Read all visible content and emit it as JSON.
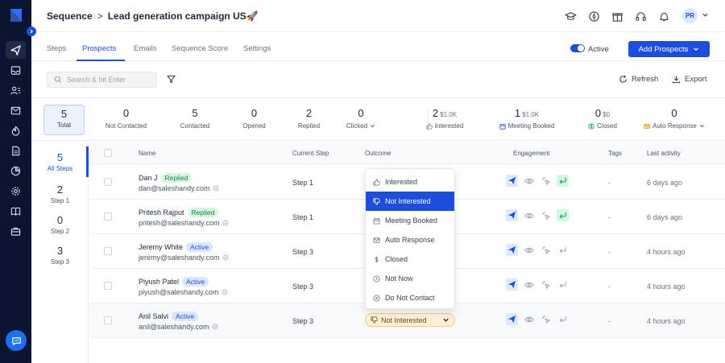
{
  "header": {
    "breadcrumb_root": "Sequence",
    "breadcrumb_sep": ">",
    "breadcrumb_current": "Lead generation campaign US",
    "title_emoji": "🚀",
    "avatar_initials": "PR"
  },
  "tabs": [
    {
      "label": "Steps"
    },
    {
      "label": "Prospects"
    },
    {
      "label": "Emails"
    },
    {
      "label": "Sequence Score"
    },
    {
      "label": "Settings"
    }
  ],
  "active_tab": "Prospects",
  "toggle": {
    "label": "Active",
    "on": true
  },
  "add_prospects_label": "Add Prospects",
  "search": {
    "placeholder": "Search & hit Enter"
  },
  "toolbar": {
    "refresh_label": "Refresh",
    "export_label": "Export"
  },
  "stats": {
    "total": {
      "value": "5",
      "label": "Total"
    },
    "not_contacted": {
      "value": "0",
      "label": "Not Contacted"
    },
    "contacted": {
      "value": "5",
      "label": "Contacted"
    },
    "opened": {
      "value": "0",
      "label": "Opened"
    },
    "replied": {
      "value": "2",
      "label": "Replied"
    },
    "clicked": {
      "value": "0",
      "label": "Clicked"
    },
    "interested": {
      "value": "2",
      "amount": "$1.0K",
      "label": "Interested"
    },
    "meeting_booked": {
      "value": "1",
      "amount": "$1.0K",
      "label": "Meeting Booked"
    },
    "closed": {
      "value": "0",
      "amount": "$0",
      "label": "Closed"
    },
    "auto_response": {
      "value": "0",
      "label": "Auto Response"
    }
  },
  "steps": [
    {
      "value": "5",
      "label": "All Steps"
    },
    {
      "value": "2",
      "label": "Step 1"
    },
    {
      "value": "0",
      "label": "Step 2"
    },
    {
      "value": "3",
      "label": "Step 3"
    }
  ],
  "table": {
    "columns": {
      "name": "Name",
      "current_step": "Current Step",
      "outcome": "Outcome",
      "engagement": "Engagement",
      "tags": "Tags",
      "last_activity": "Last activity"
    },
    "rows": [
      {
        "name": "Dan J",
        "status": "Replied",
        "email": "dan@saleshandy.com",
        "step": "Step 1",
        "tags": "-",
        "last": "6 days ago"
      },
      {
        "name": "Pritesh Rajput",
        "status": "Replied",
        "email": "pritesh@saleshandy.com",
        "step": "Step 1",
        "tags": "-",
        "last": "6 days ago"
      },
      {
        "name": "Jeremy White",
        "status": "Active",
        "email": "jeremy@saleshandy.com",
        "step": "Step 3",
        "tags": "-",
        "last": "4 hours ago"
      },
      {
        "name": "Piyush Patel",
        "status": "Active",
        "email": "piyush@saleshandy.com",
        "step": "Step 3",
        "tags": "-",
        "last": "4 hours ago"
      },
      {
        "name": "Anil Salvi",
        "status": "Active",
        "email": "anil@saleshandy.com",
        "step": "Step 3",
        "tags": "-",
        "last": "4 hours ago",
        "outcome": "Not Interested"
      }
    ]
  },
  "outcome_dropdown": {
    "options": [
      "Interested",
      "Not Interested",
      "Meeting Booked",
      "Auto Response",
      "Closed",
      "Not Now",
      "Do Not Contact"
    ],
    "selected": "Not Interested"
  },
  "colors": {
    "sidebar_bg": "#0b1430",
    "accent": "#1d4ed8",
    "replied_badge": "#d9f7e5",
    "active_badge": "#dbe7ff",
    "outcome_pill": "#fdf0d5"
  }
}
